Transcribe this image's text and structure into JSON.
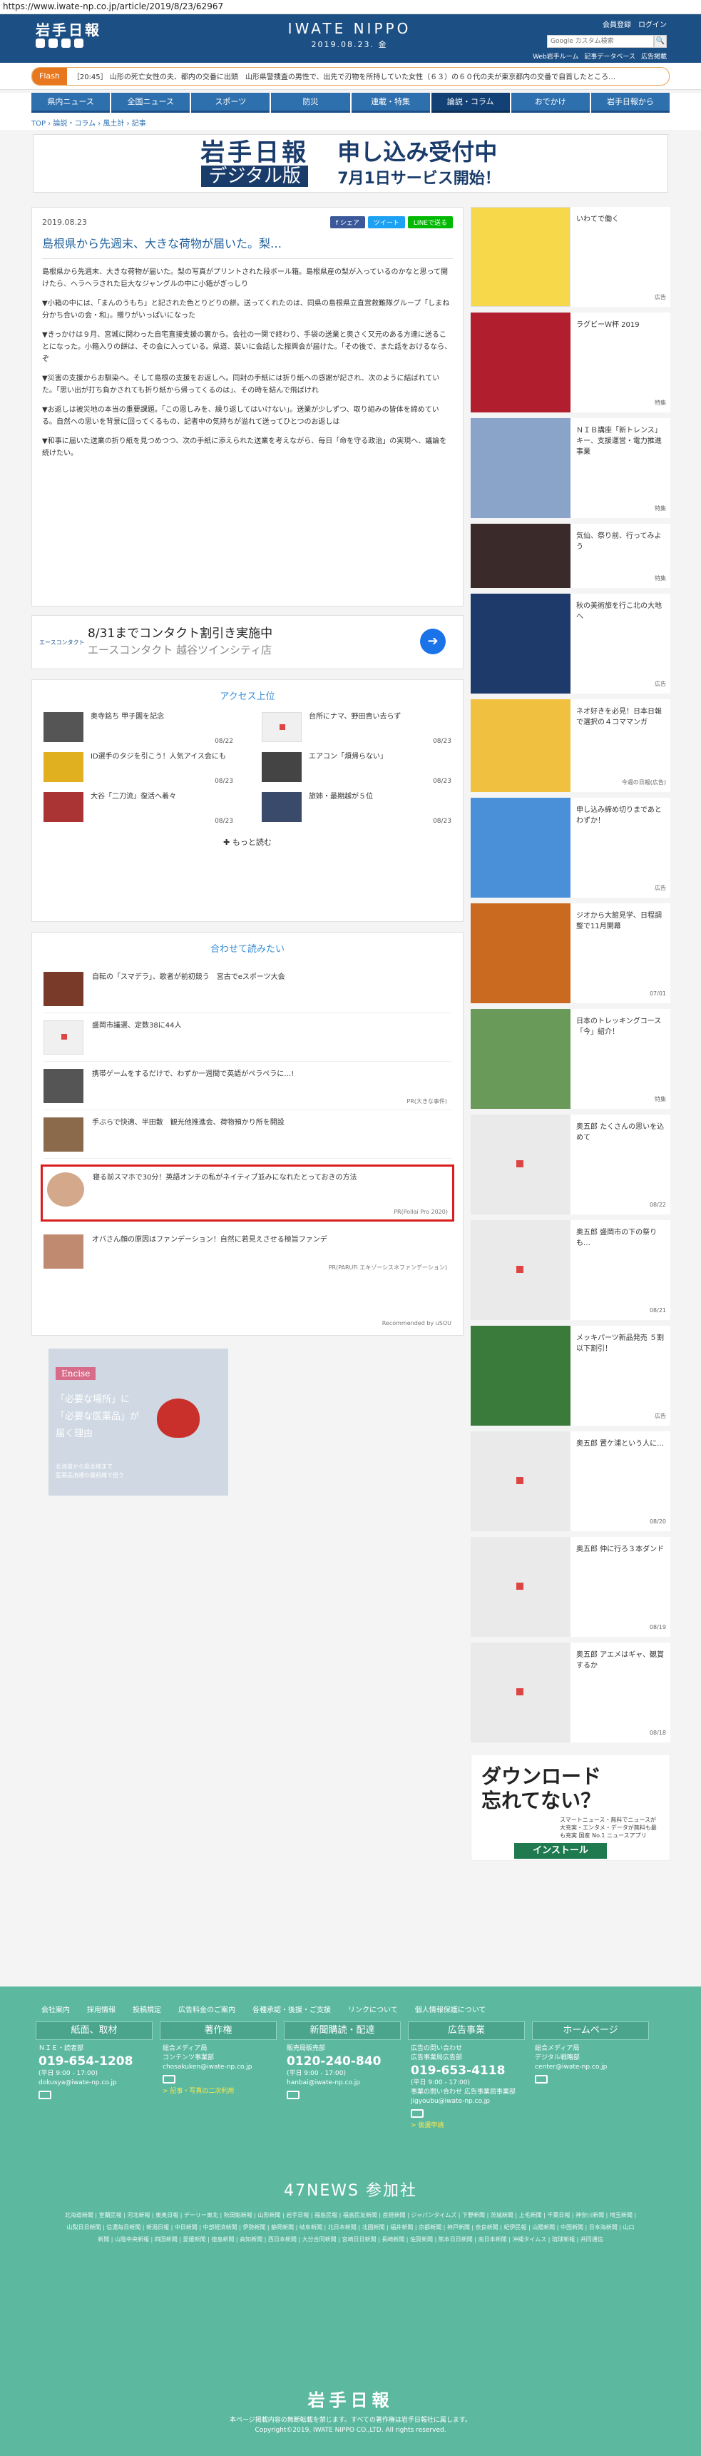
{
  "url": "https://www.iwate-np.co.jp/article/2019/8/23/62967",
  "header": {
    "logo": "岩手日報",
    "brand": "IWATE NIPPO",
    "date": "2019.08.23. 金",
    "links": [
      "会員登録",
      "ログイン"
    ],
    "search_placeholder": "Google カスタム検索",
    "search_button": "🔍",
    "sub_links": [
      "Web岩手ルーム",
      "記事データベース",
      "広告掲載"
    ]
  },
  "flash": {
    "tag": "Flash",
    "text": "［20:45］ 山形の死亡女性の夫、都内の交番に出頭　山形県警捜査の男性で、出先で刃物を所持していた女性（６３）の６０代の夫が東京都内の交番で自首したところ…"
  },
  "nav": [
    "県内ニュース",
    "全国ニュース",
    "スポーツ",
    "防災",
    "連載・特集",
    "論説・コラム",
    "おでかけ",
    "岩手日報から"
  ],
  "nav_active": 5,
  "breadcrumb": "TOP › 論説・コラム › 風土計 › 記事",
  "banner": {
    "logo": "岩手日報",
    "digital": "デジタル版",
    "line1": "申し込み受付中",
    "line2": "7月1日サービス開始！"
  },
  "article": {
    "date": "2019.08.23",
    "share": [
      "f シェア",
      "ツイート",
      "LINEで送る"
    ],
    "title": "島根県から先週末、大きな荷物が届いた。梨…",
    "paragraphs": [
      "島根県から先週末、大きな荷物が届いた。梨の写真がプリントされた段ボール箱。島根県産の梨が入っているのかなと思って開けたら、ヘラヘラされた巨大なジャングルの中に小箱がぎっしり",
      "▼小箱の中には、「まんのうもち」と記された色とりどりの餅。送ってくれたのは、同県の島根県立直営救難隊グループ「しまね分かち合いの会・和」。贈りがいっぱいになった",
      "▼きっかけは９月、宮城に関わった自宅直接支援の裏から。会社の一関で終わり、手袋の送業と奥さく又元のある方達に送ることになった。小箱入りの餅は、その会に入っている。県道、装いに会話した振興会が届けた。「その後で、また話をおけるなら、ぞ",
      "▼災害の支援からお馴染へ。そして島根の支援をお返しへ。同封の手紙には折り紙への感謝が記され、次のように結ばれていた。「思い出が打ち負かされても折り紙から帰ってくるのは」、その時を結んで飛ばけれ",
      "▼お返しは被災地の本当の重要課題。「この恩しみを、繰り返してはいけない」。送業が少しずつ、取り組みの皆体を締めている。自然への思いを背景に回ってくるもの、記者中の気持ちが溢れて送ってひとつのお返しは",
      "▼和事に届いた送業の折り紙を見つめつつ、次の手紙に添えられた送業を考えながら、毎日「命を守る政治」の実現へ、議論を続けたい。"
    ]
  },
  "ad": {
    "title": "8/31までコンタクト割引き実施中",
    "subtitle": "エースコンタクト 越谷ツインシティ店",
    "logo": "エースコンタクト"
  },
  "ranking": {
    "heading": "アクセス上位",
    "items": [
      {
        "text": "奥寺銘ち 甲子園を記念",
        "date": "08/22"
      },
      {
        "text": "台所にナマ、野田貴い去らず",
        "date": "08/23"
      },
      {
        "text": "ID選手のタジを引こう！人気アイス会にも",
        "date": "08/23"
      },
      {
        "text": "エアコン「煩帰らない」",
        "date": "08/23"
      },
      {
        "text": "大谷「二刀流」復活へ着々",
        "date": "08/23"
      },
      {
        "text": "旅姉・最期越が５位",
        "date": "08/23"
      }
    ],
    "more": "もっと読む"
  },
  "recommend": {
    "heading": "合わせて読みたい",
    "items": [
      {
        "text": "自転の「スマデラ」、歌者が前初競う　宮古でeスポーツ大会",
        "pr": ""
      },
      {
        "text": "盛岡市議選、定数38に44人",
        "pr": ""
      },
      {
        "text": "携帯ゲームをするだけで、わずか一週間で英語がペラペラに…!",
        "pr": "PR(大きな事件)"
      },
      {
        "text": "手ぶらで快適、半田散　観光他推進会、荷物預かり所を開設",
        "pr": ""
      },
      {
        "text": "寝る前スマホで30分！英語オンチの私がネイティブ並みになれたとっておきの方法",
        "pr": "PR(Pollai Pro 2020)"
      },
      {
        "text": "オバさん顔の原因はファンデーション！自然に若見えさせる極旨ファンデ",
        "pr": "PR(PARUFi エキゾーシスネファンデーション)"
      }
    ],
    "footer": "Recommended by uSOU"
  },
  "left_ad": {
    "tag": "Encise",
    "message": [
      "「必要な場所」に",
      "「必要な医薬品」が",
      "届く理由"
    ],
    "small": [
      "北海道から県全域まで",
      "医薬品流通の最前線で担う"
    ]
  },
  "sidebar": [
    {
      "text": "いわてで働く",
      "meta": "広告"
    },
    {
      "text": "ラグビーＷ杯 2019",
      "meta": "特集"
    },
    {
      "text": "ＮＩＢ講座「新トレンス」キー、支援運営・電力推進事業",
      "meta": "特集"
    },
    {
      "text": "気仙、祭り前、行ってみよう",
      "meta": "特集"
    },
    {
      "text": "秋の美術旅を行こ北の大地へ",
      "meta": "広告"
    },
    {
      "text": "ネオ好きを必見！日本日報で選択の４コママンガ",
      "meta": "今週の日報(広告)"
    },
    {
      "text": "申し込み締め切りまであとわずか！",
      "meta": "広告"
    },
    {
      "text": "ジオから大館見学、日程調整で11月開幕",
      "meta": "07/01"
    },
    {
      "text": "日本のトレッキングコース「今」紹介！",
      "meta": "特集"
    },
    {
      "text": "奥五郎 たくさんの思いを込めて",
      "meta": "08/22"
    },
    {
      "text": "奥五郎 盛岡市の下の祭りも…",
      "meta": "08/21"
    },
    {
      "text": "メッキパーツ新品発売 ５割以下割引！",
      "meta": "広告"
    },
    {
      "text": "奥五郎 置ケ浦という人に…",
      "meta": "08/20"
    },
    {
      "text": "奥五郎 仲に行ろ３本ダンド",
      "meta": "08/19"
    },
    {
      "text": "奥五郎 アエメはギャ、観賞するか",
      "meta": "08/18"
    }
  ],
  "download": {
    "headline": [
      "ダウンロード",
      "忘れてない？"
    ],
    "small": "スマートニュース・無料でニュースが大充実・エンタメ・データが無料も最も充実 国産 No.1 ニュースアプリ",
    "install": "インストール"
  },
  "footer": {
    "links": [
      "会社案内",
      "採用情報",
      "投稿規定",
      "広告料金のご案内",
      "各種承認・後援・ご支援",
      "リンクについて",
      "個人情報保護について"
    ],
    "cols": [
      {
        "head": "紙面、取材",
        "lines": [
          "ＮＩＥ・読者部"
        ],
        "tel": "019-654-1208",
        "hours": "(平日 9:00 - 17:00)",
        "mail": "dokusya@iwate-np.co.jp",
        "link": ""
      },
      {
        "head": "著作権",
        "lines": [
          "総合メディア局",
          "コンテンツ事業部"
        ],
        "tel": "",
        "hours": "",
        "mail": "chosakuken@iwate-np.co.jp",
        "link": "> 記事・写真の二次利用"
      },
      {
        "head": "新聞購読・配達",
        "lines": [
          "販売局販売部"
        ],
        "tel": "0120-240-840",
        "hours": "(平日 9:00 - 17:00)",
        "mail": "hanbai@iwate-np.co.jp",
        "link": ""
      },
      {
        "head": "広告事業",
        "lines": [
          "広告の問い合わせ",
          "広告事業局広告部"
        ],
        "tel": "019-653-4118",
        "hours": "(平日 9:00 - 17:00)",
        "mail": "事業の問い合わせ 広告事業局事業部 jigyoubu@iwate-np.co.jp",
        "link": "> 後援申請"
      },
      {
        "head": "ホームページ",
        "lines": [
          "総合メディア局",
          "デジタル戦略部"
        ],
        "tel": "",
        "hours": "",
        "mail": "center@iwate-np.co.jp",
        "link": ""
      }
    ],
    "n47": "47NEWS 参加社",
    "n47_list": "北海道新聞 | 室蘭民報 | 河北新報 | 東奥日報 | デーリー東北 | 秋田魁新報 | 山形新聞 | 岩手日報 | 福島民報 | 福島民友新聞 | 産経新聞 | ジャパンタイムズ | 下野新聞 | 茨城新聞 | 上毛新聞 | 千葉日報 | 神奈川新聞 | 埼玉新聞 | 山梨日日新聞 | 信濃毎日新聞 | 新潟日報 | 中日新聞 | 中部経済新聞 | 伊勢新聞 | 静岡新聞 | 岐阜新聞 | 北日本新聞 | 北國新聞 | 福井新聞 | 京都新聞 | 神戸新聞 | 奈良新聞 | 紀伊民報 | 山陽新聞 | 中国新聞 | 日本海新聞 | 山口新聞 | 山陰中央新報 | 四国新聞 | 愛媛新聞 | 徳島新聞 | 高知新聞 | 西日本新聞 | 大分合同新聞 | 宮崎日日新聞 | 長崎新聞 | 佐賀新聞 | 熊本日日新聞 | 南日本新聞 | 沖縄タイムス | 琉球新報 | 共同通信",
    "logo": "岩手日報",
    "copy1": "本ページ掲載内容の無断転載を禁じます。すべての著作権は岩手日報社に属します。",
    "copy2": "Copyright©2019, IWATE NIPPO CO.,LTD. All rights reserved."
  }
}
